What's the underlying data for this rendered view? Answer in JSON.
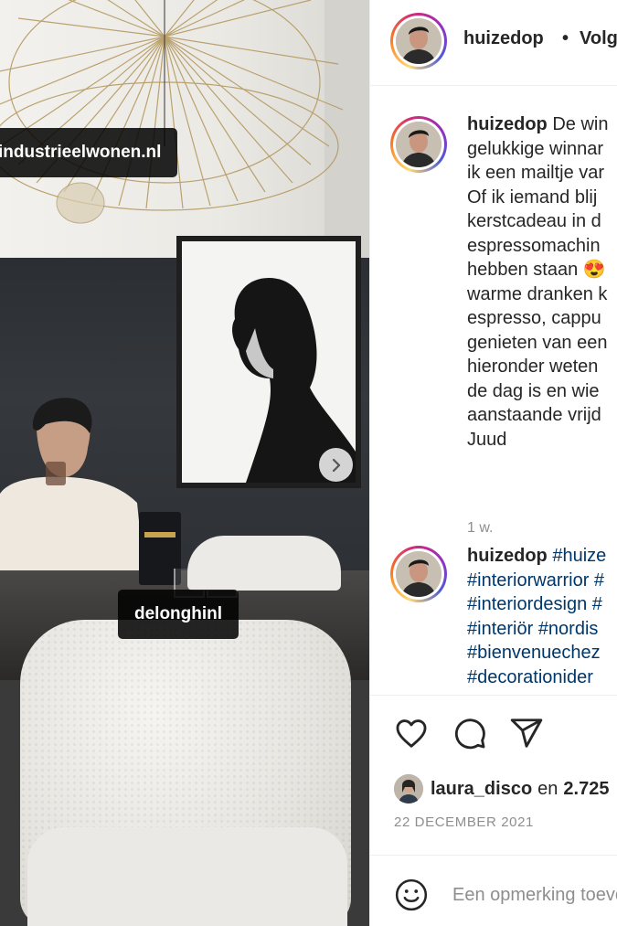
{
  "photo": {
    "tags": [
      "industrieelwonen.nl",
      "delonghinl"
    ],
    "next_icon": "chevron-right-icon"
  },
  "post": {
    "username": "huizedop",
    "separator": "•",
    "follow_label": "Volg",
    "caption_lines": [
      "De win",
      "gelukkige winnar",
      "ik een mailtje var",
      "Of ik iemand blij",
      "kerstcadeau in d",
      "espressomachin",
      "hebben staan 😍",
      "warme dranken k",
      "espresso, cappu",
      "genieten van een",
      "hieronder weten",
      "de dag is en wie",
      "aanstaande vrijd",
      "Juud"
    ],
    "time_ago": "1 w.",
    "hashtag_lines": [
      "#huize",
      "#interiorwarrior #",
      "#interiordesign #",
      "#interiör #nordis",
      "#bienvenuechez",
      "#decorationider"
    ]
  },
  "actions": {
    "icons": [
      "heart-icon",
      "comment-icon",
      "share-icon"
    ],
    "liked_by_user": "laura_disco",
    "liked_by_connector": "en",
    "liked_by_count": "2.725",
    "date": "22 DECEMBER 2021"
  },
  "comment_box": {
    "emoji_icon": "smiley-icon",
    "placeholder": "Een opmerking toevoegen..."
  },
  "colors": {
    "link": "#00376b",
    "muted": "#8e8e8e",
    "text": "#262626"
  }
}
